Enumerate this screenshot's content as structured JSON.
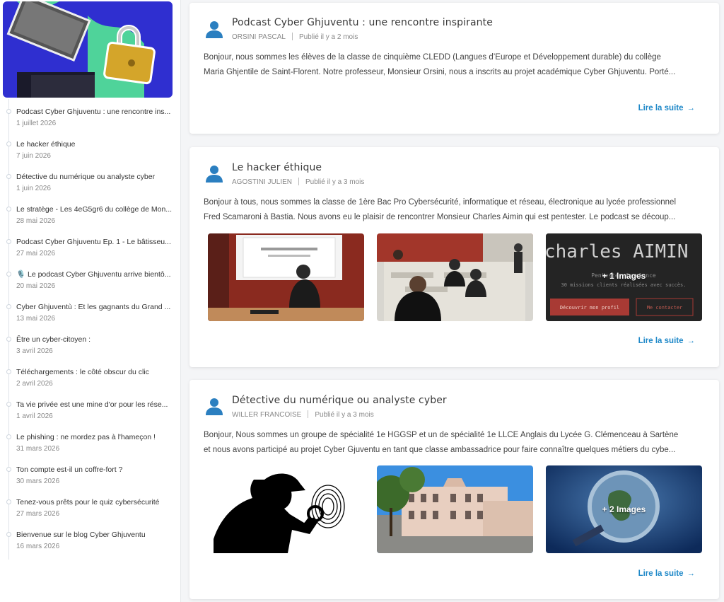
{
  "sidebar": {
    "posts": [
      {
        "title": "Podcast Cyber Ghjuventu : une rencontre ins...",
        "date": "1 juillet 2026"
      },
      {
        "title": "Le hacker éthique",
        "date": "7 juin 2026"
      },
      {
        "title": "Détective du numérique ou analyste cyber",
        "date": "1 juin 2026"
      },
      {
        "title": "Le stratège - Les 4eG5gr6 du collège de Mon...",
        "date": "28 mai 2026"
      },
      {
        "title": "Podcast Cyber Ghjuventu Ep. 1 - Le bâtisseu...",
        "date": "27 mai 2026"
      },
      {
        "title": "🎙️ Le podcast Cyber Ghjuventu arrive bientô...",
        "date": "20 mai 2026"
      },
      {
        "title": "Cyber Ghjuventù : Et les gagnants du Grand ...",
        "date": "13 mai 2026"
      },
      {
        "title": "Être un cyber-citoyen :",
        "date": "3 avril 2026"
      },
      {
        "title": "Téléchargements : le côté obscur du clic",
        "date": "2 avril 2026"
      },
      {
        "title": "Ta vie privée est une mine d'or pour les rése...",
        "date": "1 avril 2026"
      },
      {
        "title": "Le phishing : ne mordez pas à l'hameçon !",
        "date": "31 mars 2026"
      },
      {
        "title": "Ton compte est-il un coffre-fort ?",
        "date": "30 mars 2026"
      },
      {
        "title": "Tenez-vous prêts pour le quiz cybersécurité",
        "date": "27 mars 2026"
      },
      {
        "title": "Bienvenue sur le blog Cyber Ghjuventu",
        "date": "16 mars 2026"
      }
    ]
  },
  "cards": [
    {
      "title": "Podcast Cyber Ghjuventu : une rencontre inspirante",
      "author": "ORSINI PASCAL",
      "published": "Publié il y a 2 mois",
      "body_line1": "Bonjour, nous sommes les élèves de la classe de cinquième CLEDD (Langues d’Europe et Développement durable) du collège",
      "body_line2": "Maria Ghjentile de Saint-Florent. Notre professeur, Monsieur Orsini, nous a inscrits au projet académique Cyber Ghjuventu. Porté...",
      "read_more": "Lire la suite"
    },
    {
      "title": "Le hacker éthique",
      "author": "AGOSTINI JULIEN",
      "published": "Publié il y a 3 mois",
      "body_line1": "Bonjour à tous, nous sommes la classe de 1ère Bac Pro Cybersécurité, informatique et réseau, électronique au lycée professionnel",
      "body_line2": "Fred Scamaroni à Bastia. Nous avons eu le plaisir de rencontrer Monsieur Charles Aimin qui est pentester. Le podcast se découp...",
      "read_more": "Lire la suite",
      "more_images": "+ 1 Images",
      "screen_name": "charles AIMIN",
      "screen_sub": "Pentester freelance",
      "screen_missions": "30 missions clients réalisées avec succès.",
      "screen_btn1": "Découvrir mon profil",
      "screen_btn2": "Me contacter"
    },
    {
      "title": "Détective du numérique ou analyste cyber",
      "author": "WILLER FRANCOISE",
      "published": "Publié il y a 3 mois",
      "body_line1": "Bonjour, Nous sommes un groupe de spécialité 1e HGGSP et un de spécialité 1e LLCE Anglais du Lycée G. Clémenceau à Sartène",
      "body_line2": "et nous avons participé au projet Cyber Gjuventu en tant que classe ambassadrice pour faire connaître quelques métiers du cybe...",
      "read_more": "Lire la suite",
      "more_images": "+ 2 Images"
    }
  ],
  "colors": {
    "accent": "#1e88c8",
    "avatar": "#2b7fc0",
    "hero_bg": "#2f2fd0",
    "hero_green": "#4fd39a"
  },
  "icons": {
    "avatar": "user-icon",
    "arrow": "arrow-right-icon"
  }
}
